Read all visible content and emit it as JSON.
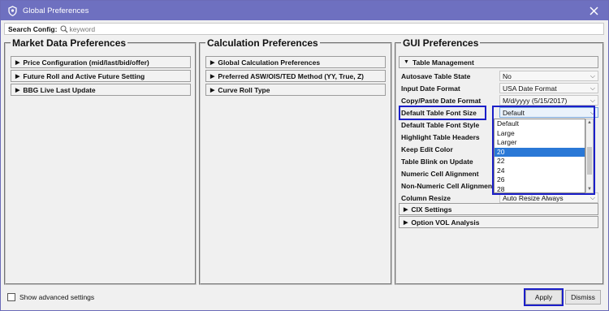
{
  "window": {
    "title": "Global Preferences"
  },
  "search": {
    "label": "Search Config:",
    "placeholder": "keyword"
  },
  "market_data": {
    "title": "Market Data Preferences",
    "sections": [
      "Price Configuration (mid/last/bid/offer)",
      "Future Roll and Active Future Setting",
      "BBG Live Last Update"
    ]
  },
  "calculation": {
    "title": "Calculation Preferences",
    "sections": [
      "Global Calculation Preferences",
      "Preferred ASW/OIS/TED Method (YY, True, Z)",
      "Curve Roll Type"
    ]
  },
  "gui": {
    "title": "GUI Preferences",
    "table_management": "Table Management",
    "rows": [
      {
        "label": "Autosave Table State",
        "value": "No"
      },
      {
        "label": "Input Date Format",
        "value": "USA Date Format"
      },
      {
        "label": "Copy/Paste Date Format",
        "value": "M/d/yyyy (5/15/2017)"
      },
      {
        "label": "Default Table Font Size",
        "value": "Default"
      },
      {
        "label": "Default Table Font Style",
        "value": ""
      },
      {
        "label": "Highlight Table Headers",
        "value": ""
      },
      {
        "label": "Keep Edit Color",
        "value": ""
      },
      {
        "label": "Table Blink on Update",
        "value": ""
      },
      {
        "label": "Numeric Cell Alignment",
        "value": ""
      },
      {
        "label": "Non-Numeric Cell Alignment",
        "value": ""
      },
      {
        "label": "Column Resize",
        "value": "Auto Resize Always"
      }
    ],
    "font_size_options": [
      "Default",
      "Large",
      "Larger",
      "20",
      "22",
      "24",
      "26",
      "28"
    ],
    "selected_option": "20",
    "collapsed_sections": [
      "CIX Settings",
      "Option VOL Analysis"
    ]
  },
  "footer": {
    "advanced_label": "Show advanced settings",
    "apply": "Apply",
    "dismiss": "Dismiss"
  },
  "colors": {
    "titlebar": "#6e70c0",
    "highlight": "#1b1fc9",
    "selection": "#2a78d6"
  }
}
